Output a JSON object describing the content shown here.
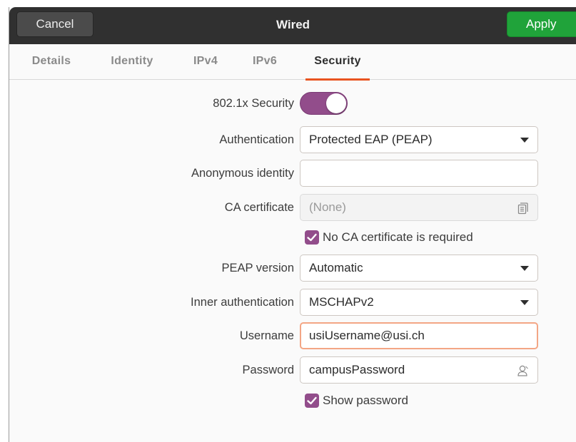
{
  "header": {
    "title": "Wired",
    "cancel_label": "Cancel",
    "apply_label": "Apply"
  },
  "tabs": [
    {
      "label": "Details",
      "active": false
    },
    {
      "label": "Identity",
      "active": false
    },
    {
      "label": "IPv4",
      "active": false
    },
    {
      "label": "IPv6",
      "active": false
    },
    {
      "label": "Security",
      "active": true
    }
  ],
  "form": {
    "security_label": "802.1x Security",
    "security_enabled": true,
    "authentication": {
      "label": "Authentication",
      "value": "Protected EAP (PEAP)"
    },
    "anonymous_identity": {
      "label": "Anonymous identity",
      "value": ""
    },
    "ca_certificate": {
      "label": "CA certificate",
      "value": "(None)"
    },
    "no_ca_required": {
      "label": "No CA certificate is required",
      "checked": true
    },
    "peap_version": {
      "label": "PEAP version",
      "value": "Automatic"
    },
    "inner_auth": {
      "label": "Inner authentication",
      "value": "MSCHAPv2"
    },
    "username": {
      "label": "Username",
      "value": "usiUsername@usi.ch"
    },
    "password": {
      "label": "Password",
      "value": "campusPassword"
    },
    "show_password": {
      "label": "Show password",
      "checked": true
    }
  },
  "colors": {
    "accent": "#924d8b",
    "apply": "#20a33a",
    "tab_underline": "#e95420",
    "focus_border": "#f3a685"
  }
}
